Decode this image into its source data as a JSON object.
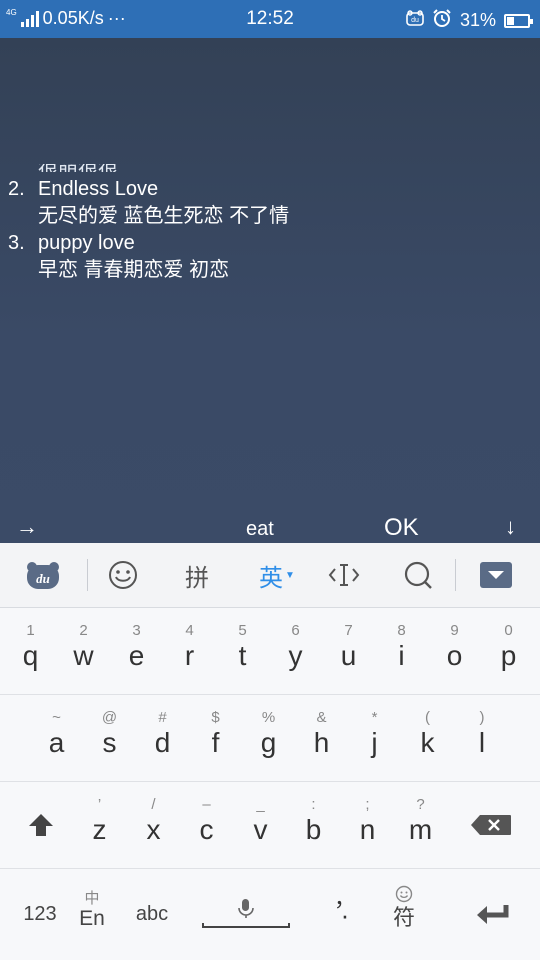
{
  "status_bar": {
    "network_type": "4G",
    "speed": "0.05K/s",
    "more": "···",
    "time": "12:52",
    "battery": "31%",
    "icons": [
      "signal-icon",
      "du-icon",
      "alarm-icon",
      "battery-icon"
    ]
  },
  "content": {
    "partial_text": "很萌很很",
    "items": [
      {
        "num": "2.",
        "title": "Endless Love",
        "meaning": "无尽的爱 蓝色生死恋 不了情"
      },
      {
        "num": "3.",
        "title": "puppy love",
        "meaning": "早恋 青春期恋爱 初恋"
      }
    ]
  },
  "candidate_bar": {
    "left_arrow": "→",
    "input_text": "eat",
    "ok": "OK",
    "down_arrow": "↓"
  },
  "toolbar": {
    "pinyin": "拼",
    "english": "英",
    "icons": [
      "du-logo-icon",
      "emoji-icon",
      "cursor-icon",
      "search-icon",
      "hide-keyboard-icon"
    ],
    "accent_color": "#2f8ee8"
  },
  "keyboard": {
    "row1": [
      {
        "hint": "1",
        "key": "q"
      },
      {
        "hint": "2",
        "key": "w"
      },
      {
        "hint": "3",
        "key": "e"
      },
      {
        "hint": "4",
        "key": "r"
      },
      {
        "hint": "5",
        "key": "t"
      },
      {
        "hint": "6",
        "key": "y"
      },
      {
        "hint": "7",
        "key": "u"
      },
      {
        "hint": "8",
        "key": "i"
      },
      {
        "hint": "9",
        "key": "o"
      },
      {
        "hint": "0",
        "key": "p"
      }
    ],
    "row2": [
      {
        "hint": "~",
        "key": "a"
      },
      {
        "hint": "@",
        "key": "s"
      },
      {
        "hint": "#",
        "key": "d"
      },
      {
        "hint": "$",
        "key": "f"
      },
      {
        "hint": "%",
        "key": "g"
      },
      {
        "hint": "&",
        "key": "h"
      },
      {
        "hint": "*",
        "key": "j"
      },
      {
        "hint": "(",
        "key": "k"
      },
      {
        "hint": ")",
        "key": "l"
      }
    ],
    "row3": [
      {
        "hint": "’",
        "key": "z"
      },
      {
        "hint": "/",
        "key": "x"
      },
      {
        "hint": "–",
        "key": "c"
      },
      {
        "hint": "_",
        "key": "v"
      },
      {
        "hint": ":",
        "key": "b"
      },
      {
        "hint": ";",
        "key": "n"
      },
      {
        "hint": "?",
        "key": "m"
      }
    ],
    "bottom": {
      "num": "123",
      "lang_hint": "中",
      "lang": "En",
      "abc": "abc",
      "comma": "，",
      "period": "·",
      "symbol": "符"
    }
  }
}
